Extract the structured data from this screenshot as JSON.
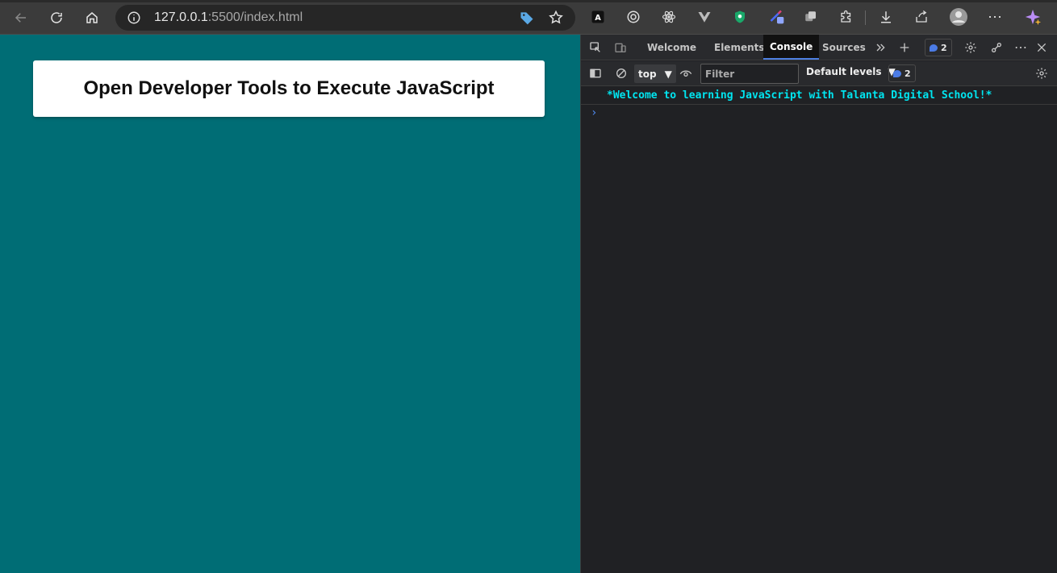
{
  "browser": {
    "url_host": "127.0.0.1",
    "url_rest": ":5500/index.html",
    "extensions": [
      "A",
      "◎",
      "⚛",
      "V",
      "●",
      "↗",
      "❐"
    ]
  },
  "page": {
    "heading": "Open Developer Tools to Execute JavaScript",
    "background": "#006d75"
  },
  "devtools": {
    "tabs": [
      "Welcome",
      "Elements",
      "Console",
      "Sources"
    ],
    "active_tab": "Console",
    "issues_count": "2",
    "context": "top",
    "filter_placeholder": "Filter",
    "levels_label": "Default levels",
    "console_issues_count": "2",
    "messages": [
      "*Welcome to learning JavaScript with Talanta Digital School!*"
    ],
    "prompt": "›"
  }
}
